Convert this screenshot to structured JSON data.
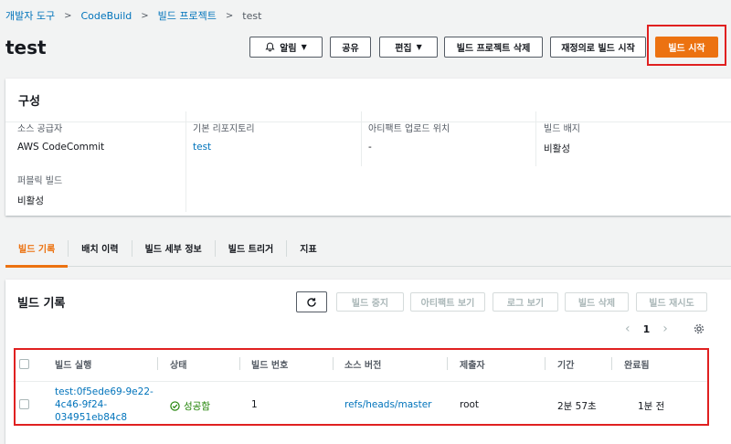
{
  "breadcrumb": {
    "items": [
      "개발자 도구",
      "CodeBuild",
      "빌드 프로젝트"
    ],
    "current": "test",
    "separator": ">"
  },
  "page_title": "test",
  "actions": {
    "notify": "알림",
    "share": "공유",
    "edit": "편집",
    "delete_project": "빌드 프로젝트 삭제",
    "retry_build": "재정의로 빌드 시작",
    "start_build": "빌드 시작"
  },
  "config": {
    "title": "구성",
    "source_provider_label": "소스 공급자",
    "source_provider_value": "AWS CodeCommit",
    "primary_repo_label": "기본 리포지토리",
    "primary_repo_value": "test",
    "artifact_label": "아티팩트 업로드 위치",
    "artifact_value": "-",
    "badge_label": "빌드 배지",
    "badge_value": "비활성",
    "public_label": "퍼블릭 빌드",
    "public_value": "비활성"
  },
  "tabs": [
    "빌드 기록",
    "배치 이력",
    "빌드 세부 정보",
    "빌드 트리거",
    "지표"
  ],
  "history": {
    "title": "빌드 기록",
    "buttons": {
      "stop": "빌드 중지",
      "artifacts": "아티팩트 보기",
      "logs": "로그 보기",
      "delete": "빌드 삭제",
      "retry": "빌드 재시도"
    },
    "page": "1",
    "columns": [
      "빌드 실행",
      "상태",
      "빌드 번호",
      "소스 버전",
      "제출자",
      "기간",
      "완료됨"
    ],
    "rows": [
      {
        "run_line1": "test:0f5ede69-9e22-",
        "run_line2": "4c46-9f24-",
        "run_line3": "034951eb84c8",
        "status": "성공함",
        "number": "1",
        "source_version": "refs/heads/master",
        "submitter": "root",
        "duration": "2분 57초",
        "completed": "1분 전"
      }
    ]
  },
  "colors": {
    "primary": "#ec7211",
    "link": "#0073bb",
    "success": "#1d8102",
    "highlight": "#e02020"
  }
}
